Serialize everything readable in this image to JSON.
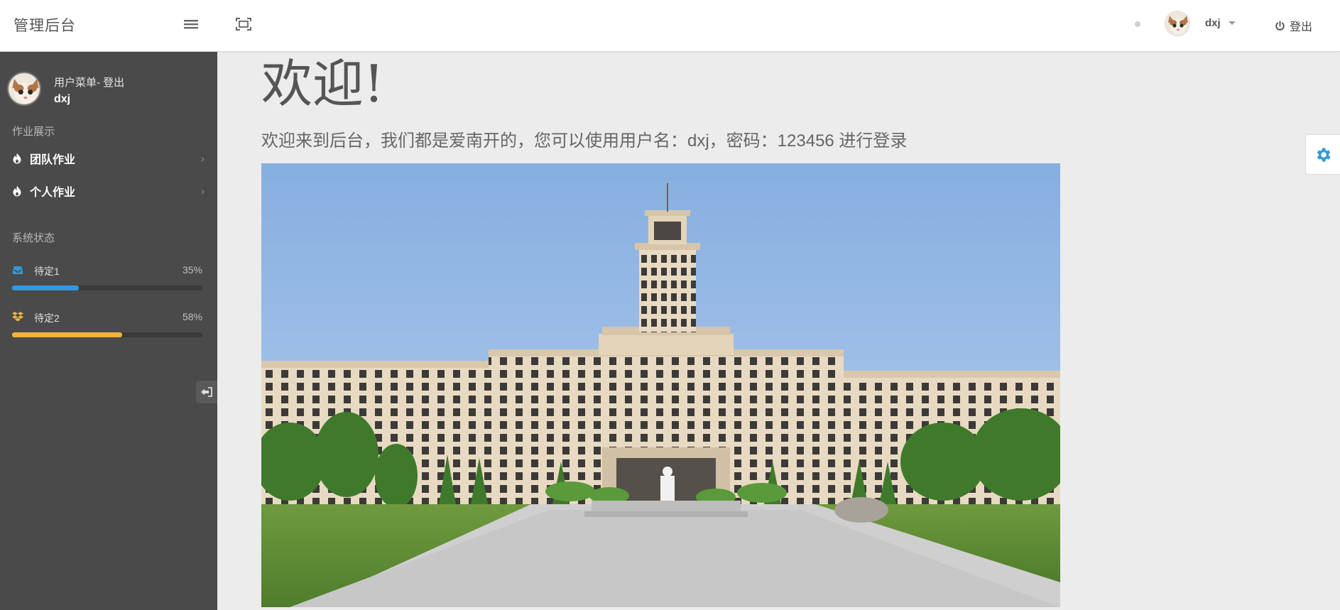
{
  "header": {
    "brand": "管理后台",
    "user_name": "dxj",
    "logout_label": "登出"
  },
  "sidebar": {
    "user_menu_label": "用户菜单- 登出",
    "username": "dxj",
    "section_homework": "作业展示",
    "items": [
      {
        "label": "团队作业",
        "icon": "fire-icon"
      },
      {
        "label": "个人作业",
        "icon": "fire-icon"
      }
    ],
    "section_status": "系统状态",
    "status": [
      {
        "label": "待定1",
        "percent_text": "35%",
        "percent": 35,
        "color": "#3498db",
        "icon": "inbox-icon"
      },
      {
        "label": "待定2",
        "percent_text": "58%",
        "percent": 58,
        "color": "#f0b43c",
        "icon": "dropbox-icon"
      }
    ]
  },
  "main": {
    "title": "欢迎!",
    "subtitle": "欢迎来到后台，我们都是爱南开的，您可以使用用户名：dxj，密码：123456 进行登录"
  },
  "colors": {
    "sidebar_bg": "#4a4a4a",
    "page_bg": "#ececec",
    "accent_blue": "#3498db",
    "accent_yellow": "#f0b43c"
  }
}
